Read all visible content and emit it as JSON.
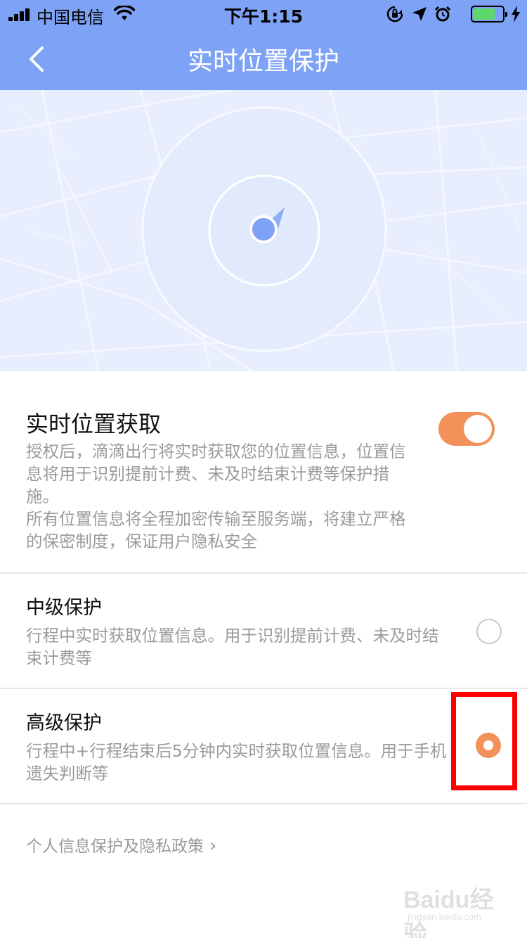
{
  "status_bar": {
    "carrier": "中国电信",
    "time": "下午1:15",
    "icons": [
      "signal-icon",
      "wifi-icon",
      "rotation-lock-icon",
      "location-arrow-icon",
      "alarm-icon",
      "battery-icon",
      "charging-icon"
    ]
  },
  "nav": {
    "title": "实时位置保护",
    "back_icon": "back-arrow-icon"
  },
  "colors": {
    "nav_bg": "#7ea2f5",
    "map_bg": "#e8eefd",
    "accent_orange": "#f2925a",
    "highlight_red": "#ff0000"
  },
  "realtime": {
    "title": "实时位置获取",
    "toggle_on": true,
    "desc_lines": [
      "授权后，滴滴出行将实时获取您的位置信息，位置信",
      "息将用于识别提前计费、未及时结束计费等保护措",
      "施。",
      "所有位置信息将全程加密传输至服务端，将建立严格",
      "的保密制度，保证用户隐私安全"
    ]
  },
  "medium": {
    "title": "中级保护",
    "selected": false,
    "desc_lines": [
      "行程中实时获取位置信息。用于识别提前计费、未及时结",
      "束计费等"
    ]
  },
  "high": {
    "title": "高级保护",
    "selected": true,
    "desc_lines": [
      "行程中+行程结束后5分钟内实时获取位置信息。用于手机",
      "遗失判断等"
    ]
  },
  "policy_link": {
    "label": "个人信息保护及隐私政策",
    "chevron": "›"
  },
  "watermark": {
    "logo": "Baidu经验",
    "url": "jingyan.baidu.com"
  }
}
